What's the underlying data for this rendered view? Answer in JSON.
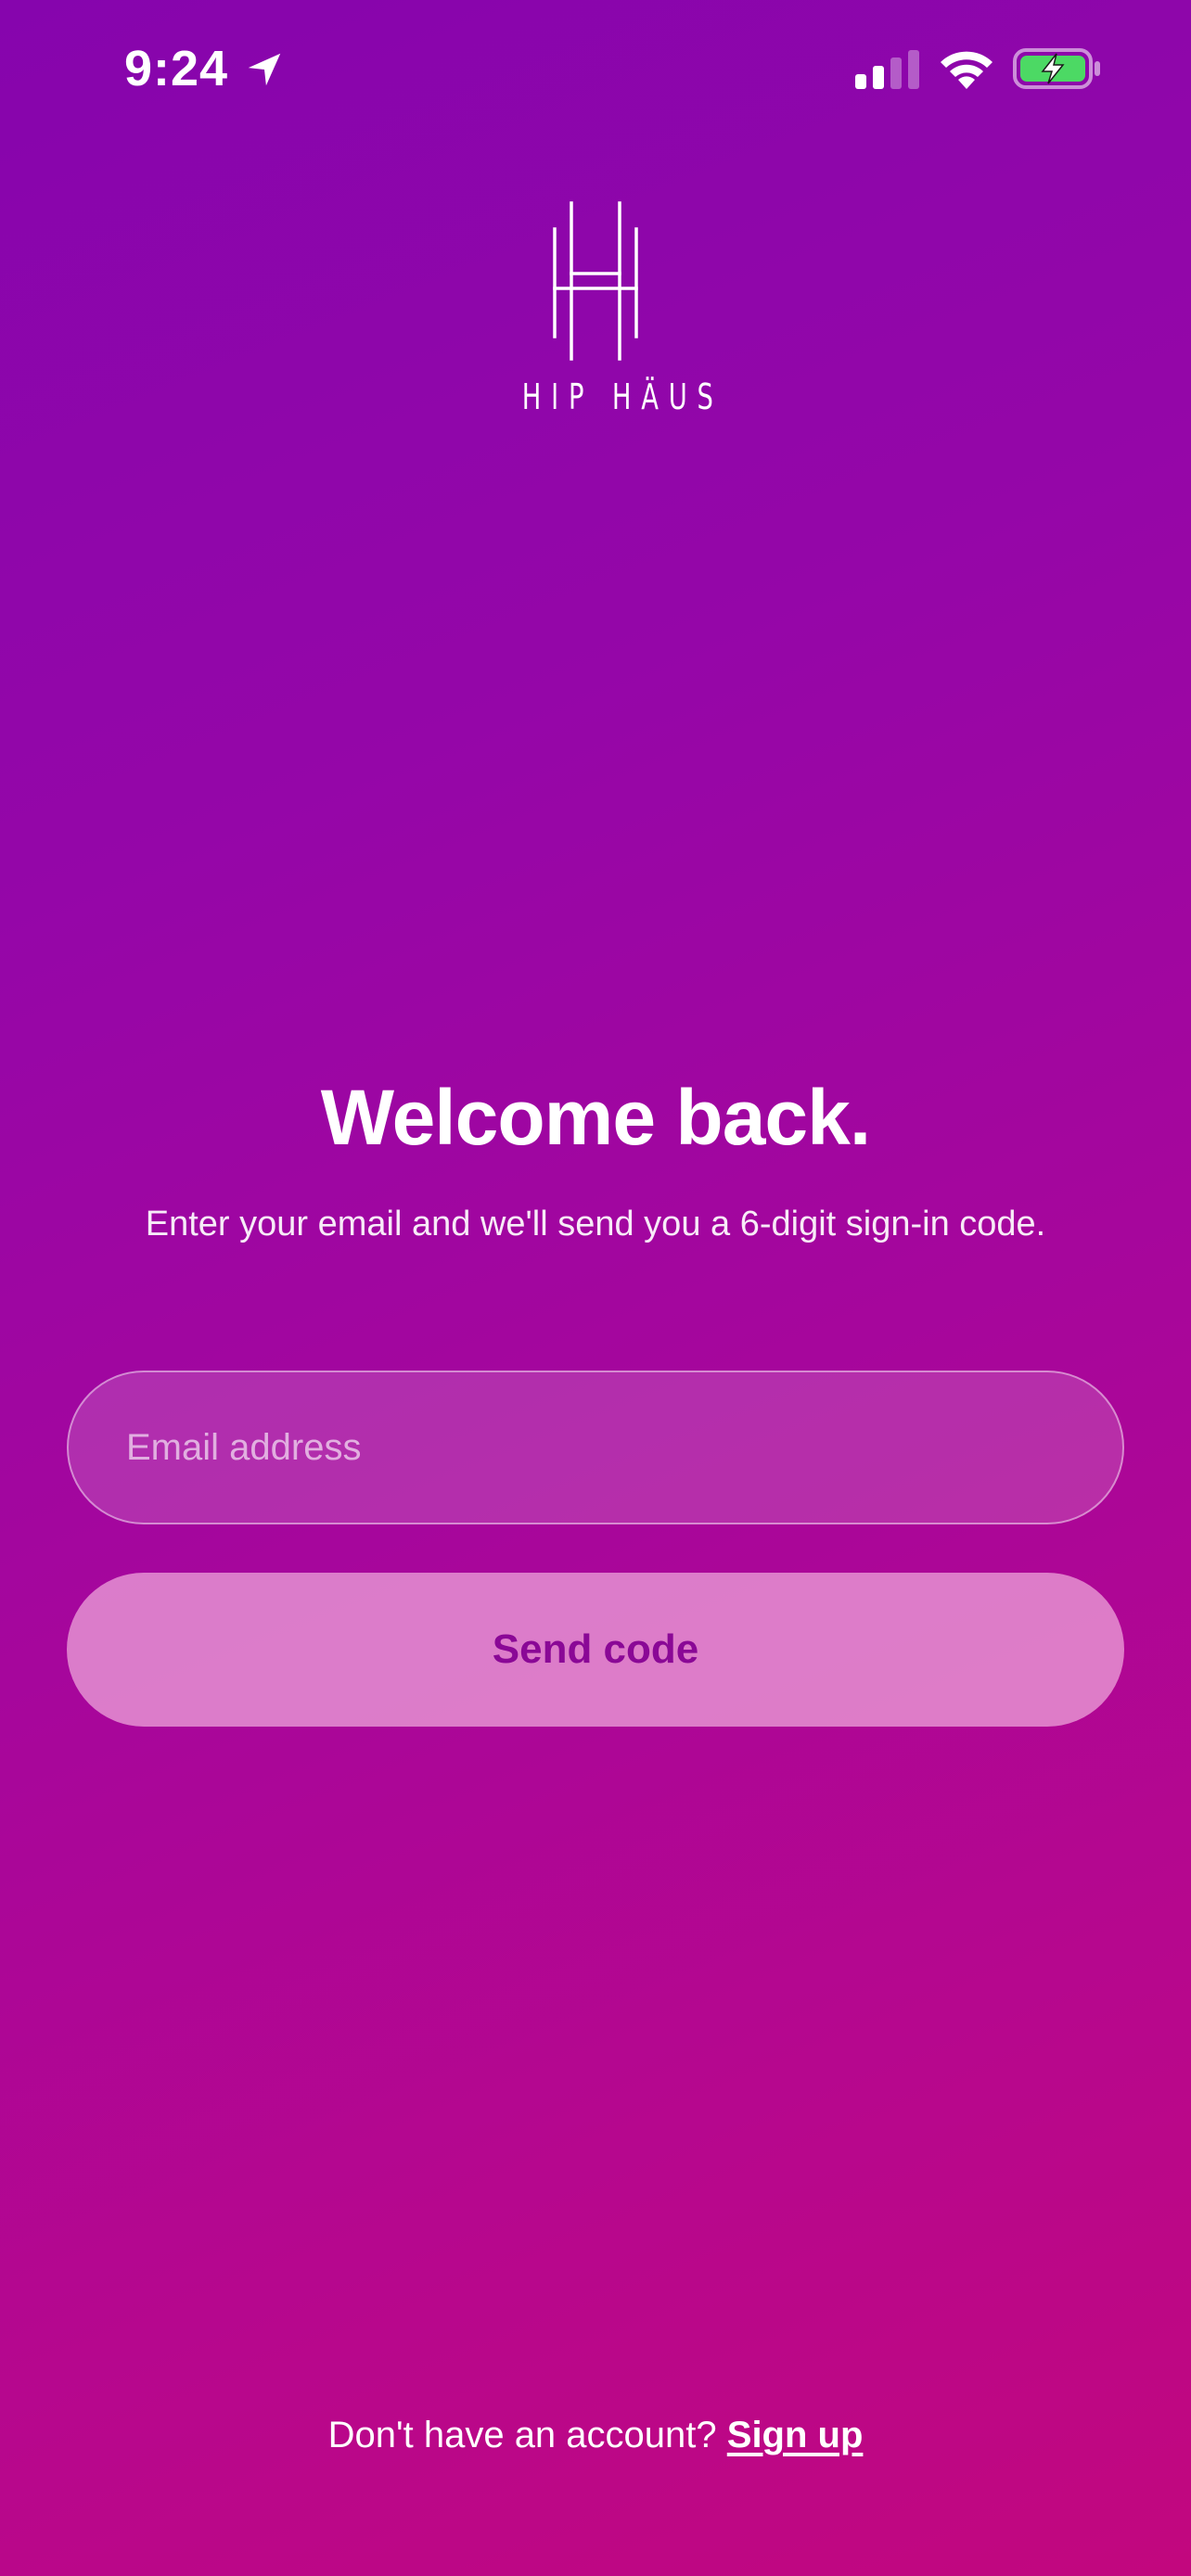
{
  "status_bar": {
    "time": "9:24",
    "icons": [
      "location-arrow-icon",
      "cellular-signal-icon",
      "wifi-icon",
      "battery-charging-icon"
    ],
    "battery_color": "#4cd964"
  },
  "logo": {
    "text": "HIP HÄUS"
  },
  "heading": {
    "title": "Welcome back.",
    "subtitle": "Enter your email and we'll send you a 6-digit sign-in code."
  },
  "form": {
    "email_placeholder": "Email address",
    "email_value": "",
    "send_label": "Send code"
  },
  "footer": {
    "prompt": "Don't have an account?",
    "signup_label": "Sign up"
  },
  "colors": {
    "gradient_top": "#8605ad",
    "gradient_bottom": "#c2077e",
    "button_text": "#8a0896"
  }
}
